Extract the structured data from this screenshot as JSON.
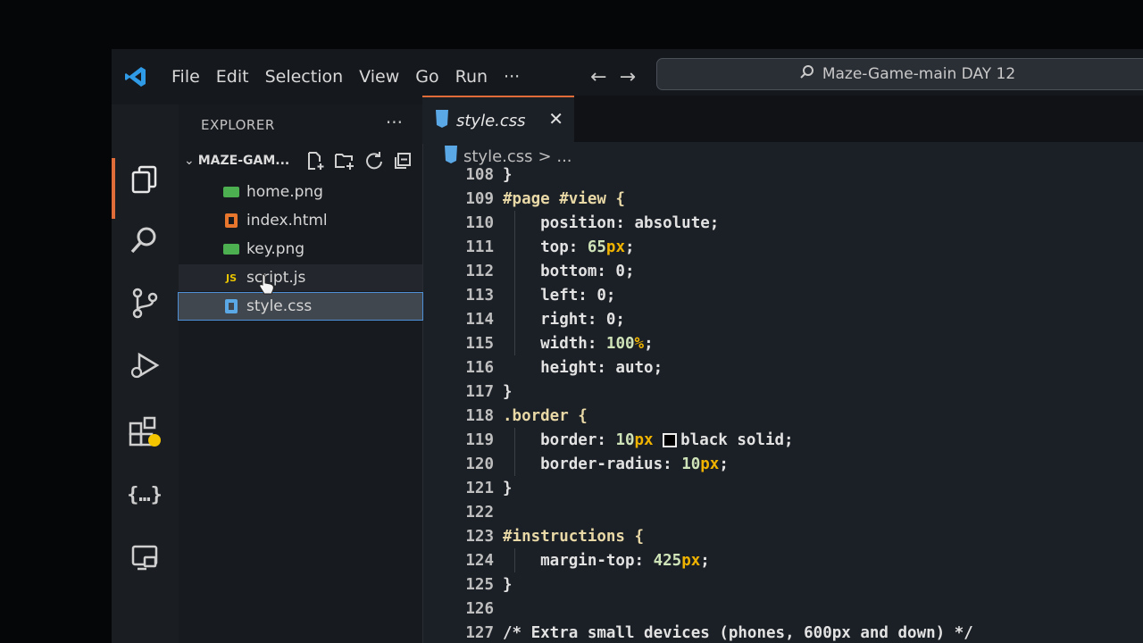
{
  "menu": [
    "File",
    "Edit",
    "Selection",
    "View",
    "Go",
    "Run",
    "···"
  ],
  "nav": {
    "back": "←",
    "forward": "→"
  },
  "search": {
    "text": "Maze-Game-main DAY 12"
  },
  "explorer": {
    "title": "EXPLORER",
    "more": "···",
    "folder": "MAZE-GAM...",
    "files": [
      {
        "name": "home.png",
        "icon": "image-icon",
        "color": "#4caf50"
      },
      {
        "name": "index.html",
        "icon": "html-icon",
        "color": "#e8762d"
      },
      {
        "name": "key.png",
        "icon": "image-icon",
        "color": "#4caf50"
      },
      {
        "name": "script.js",
        "icon": "js-icon",
        "color": "#e8c300",
        "badge": "JS"
      },
      {
        "name": "style.css",
        "icon": "css-icon",
        "color": "#5aa8e6"
      }
    ]
  },
  "tab": {
    "label": "style.css",
    "close": "✕"
  },
  "breadcrumb": {
    "file": "style.css",
    "rest": "> ..."
  },
  "code": {
    "lines": [
      {
        "n": "108",
        "t": "}"
      },
      {
        "n": "109",
        "t": "#page #view {"
      },
      {
        "n": "110",
        "t": "    position: absolute;"
      },
      {
        "n": "111",
        "t": "    top: 65px;"
      },
      {
        "n": "112",
        "t": "    bottom: 0;"
      },
      {
        "n": "113",
        "t": "    left: 0;"
      },
      {
        "n": "114",
        "t": "    right: 0;"
      },
      {
        "n": "115",
        "t": "    width: 100%;"
      },
      {
        "n": "116",
        "t": "    height: auto;"
      },
      {
        "n": "117",
        "t": "}"
      },
      {
        "n": "118",
        "t": ".border {"
      },
      {
        "n": "119",
        "t": "    border: 10px black solid;"
      },
      {
        "n": "120",
        "t": "    border-radius: 10px;"
      },
      {
        "n": "121",
        "t": "}"
      },
      {
        "n": "122",
        "t": ""
      },
      {
        "n": "123",
        "t": "#instructions {"
      },
      {
        "n": "124",
        "t": "    margin-top: 425px;"
      },
      {
        "n": "125",
        "t": "}"
      },
      {
        "n": "126",
        "t": ""
      },
      {
        "n": "127",
        "t": "/* Extra small devices (phones, 600px and down) */"
      }
    ]
  },
  "colors": {
    "accent": "#e06c3a",
    "number": "#cfe3b8",
    "unit": "#f0b400",
    "selection": "#4f8fd6"
  }
}
